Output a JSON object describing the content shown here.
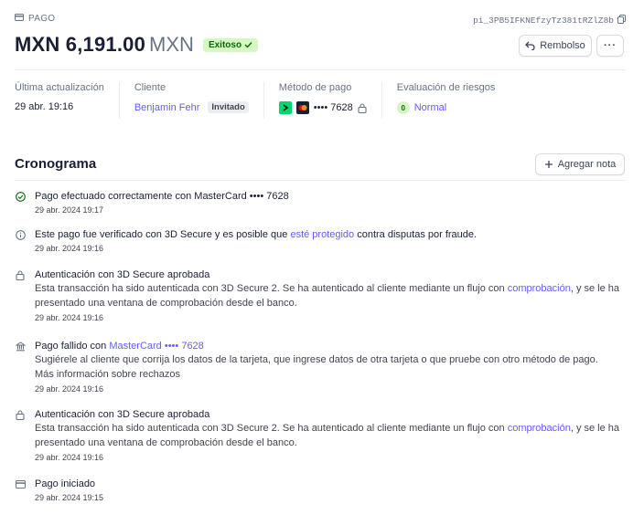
{
  "header": {
    "tag": "PAGO",
    "payment_id": "pi_3PB5IFKNEfzyTz381tRZlZ8b",
    "amount": "MXN 6,191.00",
    "currency": "MXN",
    "status": "Exitoso",
    "refund_label": "Rembolso",
    "more_label": "···"
  },
  "summary": {
    "last_update": {
      "label": "Última actualización",
      "value": "29 abr. 19:16"
    },
    "customer": {
      "label": "Cliente",
      "name": "Benjamin Fehr",
      "badge": "Invitado"
    },
    "payment_method": {
      "label": "Método de pago",
      "card": "•••• 7628"
    },
    "risk": {
      "label": "Evaluación de riesgos",
      "score": "0",
      "level": "Normal"
    }
  },
  "timeline": {
    "title": "Cronograma",
    "add_note_label": "Agregar nota",
    "events": [
      {
        "icon": "check-circle-icon",
        "title": "Pago efectuado correctamente con MasterCard •••• 7628",
        "time": "29 abr. 2024 19:17"
      },
      {
        "icon": "info-icon",
        "title_pre": "Este pago fue verificado con 3D Secure y es posible que ",
        "title_link": "esté protegido",
        "title_post": " contra disputas por fraude.",
        "time": "29 abr. 2024 19:16"
      },
      {
        "icon": "lock-icon",
        "title": "Autenticación con 3D Secure aprobada",
        "desc_pre": "Esta transacción ha sido autenticada con 3D Secure 2. Se ha autenticado al cliente mediante un flujo con ",
        "desc_link": "comprobación",
        "desc_post": ", y se le ha presentado una ventana de comprobación desde el banco.",
        "time": "29 abr. 2024 19:16"
      },
      {
        "icon": "bank-icon",
        "title_pre": "Pago fallido con ",
        "title_link": "MasterCard •••• 7628",
        "desc": "Sugiérele al cliente que corrija los datos de la tarjeta, que ingrese datos de otra tarjeta o que pruebe con otro método de pago.",
        "desc_link2": "Más información sobre rechazos",
        "time": "29 abr. 2024 19:16"
      },
      {
        "icon": "lock-icon",
        "title": "Autenticación con 3D Secure aprobada",
        "desc_pre": "Esta transacción ha sido autenticada con 3D Secure 2. Se ha autenticado al cliente mediante un flujo con ",
        "desc_link": "comprobación",
        "desc_post": ", y se le ha presentado una ventana de comprobación desde el banco.",
        "time": "29 abr. 2024 19:16"
      },
      {
        "icon": "payment-icon",
        "title": "Pago iniciado",
        "time": "29 abr. 2024 19:15"
      }
    ]
  },
  "colors": {
    "accent": "#635bff",
    "success_bg": "#d7f7c2",
    "success_fg": "#05690d"
  }
}
